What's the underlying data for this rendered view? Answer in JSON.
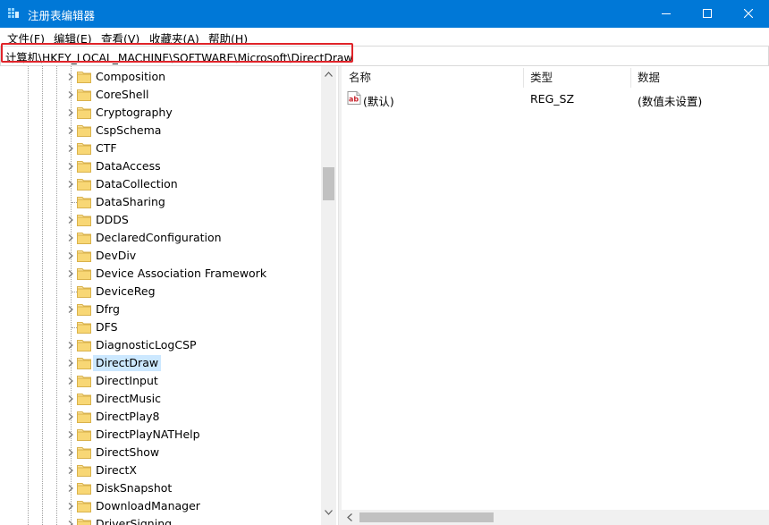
{
  "window": {
    "title": "注册表编辑器",
    "accent_color": "#0078d7",
    "controls": {
      "minimize_icon": "minimize-icon",
      "maximize_icon": "maximize-icon",
      "close_icon": "close-icon"
    }
  },
  "menu": {
    "items": [
      {
        "label": "文件(F)"
      },
      {
        "label": "编辑(E)"
      },
      {
        "label": "查看(V)"
      },
      {
        "label": "收藏夹(A)"
      },
      {
        "label": "帮助(H)"
      }
    ]
  },
  "address": {
    "path": "计算机\\HKEY_LOCAL_MACHINE\\SOFTWARE\\Microsoft\\DirectDraw",
    "highlight_color": "#e0242a"
  },
  "tree": {
    "selected": "DirectDraw",
    "selection_color": "#cce8ff",
    "folder_color": "#f8d775",
    "items": [
      {
        "label": "Composition",
        "expandable": true
      },
      {
        "label": "CoreShell",
        "expandable": true
      },
      {
        "label": "Cryptography",
        "expandable": true
      },
      {
        "label": "CspSchema",
        "expandable": true
      },
      {
        "label": "CTF",
        "expandable": true
      },
      {
        "label": "DataAccess",
        "expandable": true
      },
      {
        "label": "DataCollection",
        "expandable": true
      },
      {
        "label": "DataSharing",
        "expandable": false
      },
      {
        "label": "DDDS",
        "expandable": true
      },
      {
        "label": "DeclaredConfiguration",
        "expandable": true
      },
      {
        "label": "DevDiv",
        "expandable": true
      },
      {
        "label": "Device Association Framework",
        "expandable": true
      },
      {
        "label": "DeviceReg",
        "expandable": false
      },
      {
        "label": "Dfrg",
        "expandable": true
      },
      {
        "label": "DFS",
        "expandable": false
      },
      {
        "label": "DiagnosticLogCSP",
        "expandable": true
      },
      {
        "label": "DirectDraw",
        "expandable": true
      },
      {
        "label": "DirectInput",
        "expandable": true
      },
      {
        "label": "DirectMusic",
        "expandable": true
      },
      {
        "label": "DirectPlay8",
        "expandable": true
      },
      {
        "label": "DirectPlayNATHelp",
        "expandable": true
      },
      {
        "label": "DirectShow",
        "expandable": true
      },
      {
        "label": "DirectX",
        "expandable": true
      },
      {
        "label": "DiskSnapshot",
        "expandable": true
      },
      {
        "label": "DownloadManager",
        "expandable": true
      },
      {
        "label": "DriverSigning",
        "expandable": true
      }
    ]
  },
  "list": {
    "columns": [
      {
        "label": "名称"
      },
      {
        "label": "类型"
      },
      {
        "label": "数据"
      }
    ],
    "rows": [
      {
        "icon": "string-value-icon",
        "name": "(默认)",
        "type": "REG_SZ",
        "data": "(数值未设置)"
      }
    ]
  }
}
